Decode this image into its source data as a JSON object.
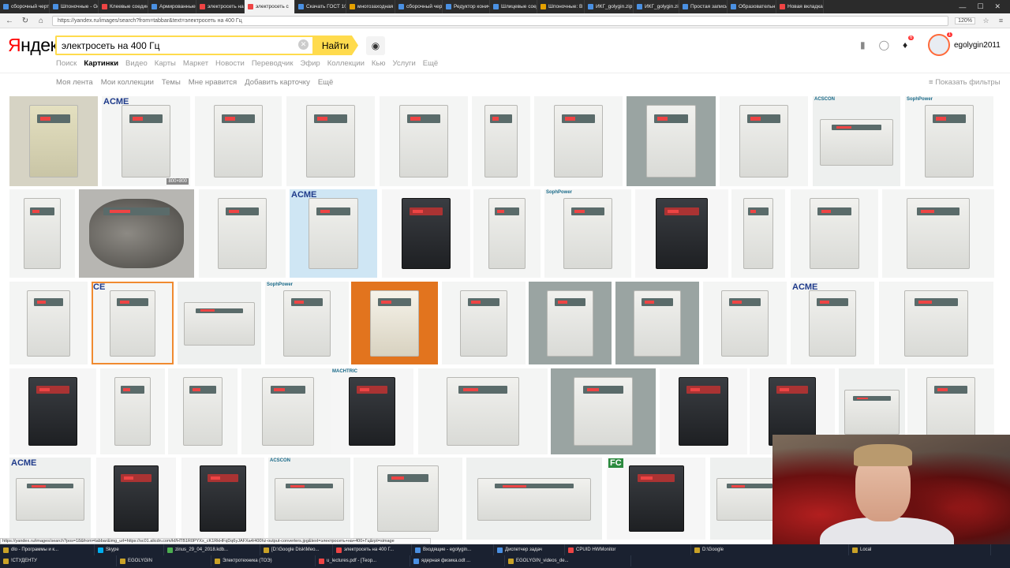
{
  "browser": {
    "tabs": [
      {
        "label": "сборочный черт",
        "color": "#4a90e2",
        "active": false
      },
      {
        "label": "Шпоночные - Go",
        "color": "#4a90e2",
        "active": false
      },
      {
        "label": "Клеевые соедин",
        "color": "#e44",
        "active": false
      },
      {
        "label": "Армированные",
        "color": "#4a90e2",
        "active": false
      },
      {
        "label": "электросеть на",
        "color": "#e44",
        "active": false
      },
      {
        "label": "электросеть с",
        "color": "#e44",
        "active": true
      },
      {
        "label": "Скачать ГОСТ 1092",
        "color": "#4a90e2",
        "active": false
      },
      {
        "label": "многозаходная",
        "color": "#e5a100",
        "active": false
      },
      {
        "label": "сборочный черт",
        "color": "#4a90e2",
        "active": false
      },
      {
        "label": "Редуктор конич",
        "color": "#4a90e2",
        "active": false
      },
      {
        "label": "Шлицевые соед",
        "color": "#4a90e2",
        "active": false
      },
      {
        "label": "Шпоночные: В ч",
        "color": "#e5a100",
        "active": false
      },
      {
        "label": "ИКГ_golygin.zip",
        "color": "#4a90e2",
        "active": false
      },
      {
        "label": "ИКГ_golygin.zip",
        "color": "#4a90e2",
        "active": false
      },
      {
        "label": "Простая запись",
        "color": "#4a90e2",
        "active": false
      },
      {
        "label": "Образовательн",
        "color": "#4a90e2",
        "active": false
      },
      {
        "label": "Новая вкладка",
        "color": "#e44",
        "active": false
      }
    ],
    "url": "https://yandex.ru/images/search?from=tabbar&text=электросеть на 400 Гц",
    "zoom": "120%"
  },
  "header": {
    "logo_ya": "Я",
    "logo_rest": "ндекс",
    "query": "электросеть на 400 Гц",
    "find_label": "Найти",
    "services": [
      {
        "label": "Поиск",
        "active": false
      },
      {
        "label": "Картинки",
        "active": true
      },
      {
        "label": "Видео",
        "active": false
      },
      {
        "label": "Карты",
        "active": false
      },
      {
        "label": "Маркет",
        "active": false
      },
      {
        "label": "Новости",
        "active": false
      },
      {
        "label": "Переводчик",
        "active": false
      },
      {
        "label": "Эфир",
        "active": false
      },
      {
        "label": "Коллекции",
        "active": false
      },
      {
        "label": "Кью",
        "active": false
      },
      {
        "label": "Услуги",
        "active": false
      },
      {
        "label": "Ещё",
        "active": false
      }
    ],
    "notif_count": "6",
    "avatar_badge": "1",
    "username": "egolygin2011"
  },
  "toolbar": {
    "items": [
      "Моя лента",
      "Мои коллекции",
      "Темы",
      "Мне нравится",
      "Добавить карточку",
      "Ещё"
    ],
    "filters_label": "Показать фильтры"
  },
  "tiles": [
    {
      "brand": "",
      "size": "",
      "style": "beige"
    },
    {
      "brand": "ACME",
      "size": "800×800",
      "style": "cab"
    },
    {
      "brand": "",
      "size": "",
      "style": "cab"
    },
    {
      "brand": "",
      "size": "",
      "style": "cab"
    },
    {
      "brand": "",
      "size": "",
      "style": "cab"
    },
    {
      "brand": "",
      "size": "",
      "style": "cab"
    },
    {
      "brand": "",
      "size": "",
      "style": "cab"
    },
    {
      "brand": "",
      "size": "",
      "style": "factory"
    },
    {
      "brand": "",
      "size": "",
      "style": "cab"
    },
    {
      "brand": "ACSCON",
      "size": "",
      "style": "wide"
    },
    {
      "brand": "SophPower",
      "size": "",
      "style": "cab"
    },
    {
      "brand": "",
      "size": "",
      "style": "cab"
    },
    {
      "brand": "",
      "size": "",
      "style": "motor"
    },
    {
      "brand": "",
      "size": "",
      "style": "cab"
    },
    {
      "brand": "ACME",
      "size": "",
      "style": "cart"
    },
    {
      "brand": "",
      "size": "",
      "style": "dark"
    },
    {
      "brand": "",
      "size": "",
      "style": "cab"
    },
    {
      "brand": "SophPower",
      "size": "",
      "style": "cab"
    },
    {
      "brand": "",
      "size": "",
      "style": "dark"
    },
    {
      "brand": "",
      "size": "",
      "style": "cab"
    },
    {
      "brand": "",
      "size": "",
      "style": "cab"
    },
    {
      "brand": "",
      "size": "",
      "style": "cab"
    },
    {
      "brand": "",
      "size": "",
      "style": "cab"
    },
    {
      "brand": "CE",
      "size": "",
      "style": "cab",
      "selected": true
    },
    {
      "brand": "",
      "size": "",
      "style": "wide"
    },
    {
      "brand": "SophPower",
      "size": "",
      "style": "cab"
    },
    {
      "brand": "",
      "size": "",
      "style": "orange"
    },
    {
      "brand": "",
      "size": "",
      "style": "cab"
    },
    {
      "brand": "",
      "size": "",
      "style": "factory"
    },
    {
      "brand": "",
      "size": "",
      "style": "factory"
    },
    {
      "brand": "",
      "size": "",
      "style": "cab"
    },
    {
      "brand": "ACME",
      "size": "",
      "style": "cab"
    },
    {
      "brand": "",
      "size": "",
      "style": "cab"
    },
    {
      "brand": "",
      "size": "",
      "style": "dark"
    },
    {
      "brand": "",
      "size": "",
      "style": "cab"
    },
    {
      "brand": "",
      "size": "",
      "style": "cab"
    },
    {
      "brand": "",
      "size": "",
      "style": "cab"
    },
    {
      "brand": "MACHTRIC",
      "size": "",
      "style": "dark"
    },
    {
      "brand": "",
      "size": "",
      "style": "cab"
    },
    {
      "brand": "",
      "size": "",
      "style": "factory"
    },
    {
      "brand": "",
      "size": "",
      "style": "dark"
    },
    {
      "brand": "",
      "size": "",
      "style": "dark"
    },
    {
      "brand": "",
      "size": "",
      "style": "wide"
    },
    {
      "brand": "",
      "size": "",
      "style": "cab"
    },
    {
      "brand": "ACME",
      "size": "",
      "style": "wide"
    },
    {
      "brand": "",
      "size": "",
      "style": "dark"
    },
    {
      "brand": "",
      "size": "",
      "style": "dark"
    },
    {
      "brand": "ACSCON",
      "size": "",
      "style": "wide"
    },
    {
      "brand": "",
      "size": "",
      "style": "cab"
    },
    {
      "brand": "",
      "size": "",
      "style": "wide"
    },
    {
      "brand": "FC",
      "size": "",
      "style": "dark"
    },
    {
      "brand": "",
      "size": "",
      "style": "wide"
    }
  ],
  "statusbar_url": "https://yandex.ru/images/search?pos=18&from=tabbar&img_url=https://sc01.alicdn.com/kf/HTB1R0PYXx_cK1RkHFqDq6yJAFXa4/400hz-output-converters.jpg&text=электросеть+на+400+Гц&rpt=simage",
  "taskbar": {
    "items": [
      {
        "label": "dlo - Программы и к...",
        "color": "#c9a227"
      },
      {
        "label": "Skype",
        "color": "#00aff0"
      },
      {
        "label": "zinus_29_04_2018.kdb...",
        "color": "#4caf50"
      },
      {
        "label": "[D:\\Google Disk\\Мео...",
        "color": "#c9a227"
      },
      {
        "label": "электросеть на 400 Г...",
        "color": "#e44"
      },
      {
        "label": "Входящие - egolygin...",
        "color": "#4a90e2"
      },
      {
        "label": "Диспетчер задач",
        "color": "#4a90e2"
      },
      {
        "label": "CPUID HWMonitor",
        "color": "#e44"
      },
      {
        "label": "D:\\Google",
        "color": "#c9a227"
      },
      {
        "label": "Local",
        "color": "#c9a227"
      },
      {
        "label": "!СТУДЕНТУ",
        "color": "#c9a227"
      },
      {
        "label": "EGOLYGIN",
        "color": "#c9a227"
      },
      {
        "label": "Электротехника (ТОЭ)",
        "color": "#c9a227"
      },
      {
        "label": "u_lectures.pdf - [Теор...",
        "color": "#e44"
      },
      {
        "label": "ядерная физика.odt ...",
        "color": "#4a90e2"
      },
      {
        "label": "EGOLYGIN_videos_de...",
        "color": "#c9a227"
      }
    ]
  }
}
